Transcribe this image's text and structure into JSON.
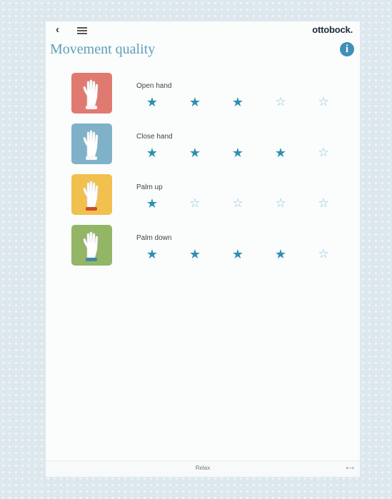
{
  "header": {
    "back_icon": "back-arrow-icon",
    "menu_icon": "hamburger-menu-icon",
    "brand": "ottobock."
  },
  "page": {
    "title": "Movement quality",
    "info_icon": "info-icon",
    "info_glyph": "i"
  },
  "movements": [
    {
      "label": "Open hand",
      "rating": 3,
      "max": 5,
      "tile_color": "#e07a70",
      "icon": "open-hand-icon"
    },
    {
      "label": "Close hand",
      "rating": 4,
      "max": 5,
      "tile_color": "#7fb2c8",
      "icon": "close-hand-icon"
    },
    {
      "label": "Palm up",
      "rating": 1,
      "max": 5,
      "tile_color": "#f2c04e",
      "icon": "palm-up-icon"
    },
    {
      "label": "Palm down",
      "rating": 4,
      "max": 5,
      "tile_color": "#93b566",
      "icon": "palm-down-icon"
    }
  ],
  "footer": {
    "label": "Relax",
    "icon_glyph": "⟷"
  },
  "colors": {
    "accent": "#3f8fb8",
    "star_filled": "#2f8fb2",
    "star_empty": "#8fc3d6",
    "title": "#5aa0b8"
  }
}
